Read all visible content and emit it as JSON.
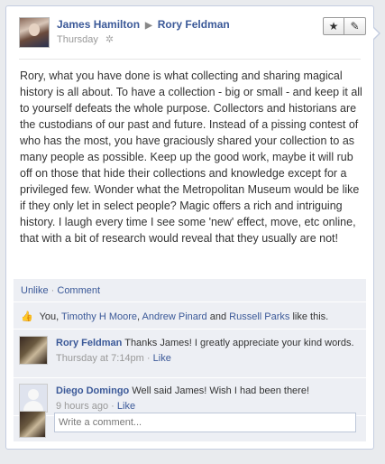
{
  "post": {
    "author": "James Hamilton",
    "recipient": "Rory Feldman",
    "time": "Thursday",
    "body": "Rory, what you have done is what collecting and sharing magical history is all about. To have a collection - big or small - and keep it all to yourself defeats the whole purpose. Collectors and historians are the custodians of our past and future. Instead of a pissing contest of who has the most, you have graciously shared your collection to as many people as possible. Keep up the good work, maybe it will rub off on those that hide their collections and knowledge except for a privileged few. Wonder what the Metropolitan Museum would be like if they only let in select people? Magic offers a rich and intriguing history. I laugh every time I see some 'new' effect, move, etc online, that with a bit of research would reveal that they usually are not!"
  },
  "actions": {
    "unlike": "Unlike",
    "comment": "Comment",
    "separator": "·"
  },
  "likes": {
    "you": "You,",
    "people": [
      "Timothy H Moore",
      "Andrew Pinard",
      "Russell Parks"
    ],
    "comma": ",",
    "and": "and",
    "suffix": "like this."
  },
  "comments": [
    {
      "author": "Rory Feldman",
      "text": "Thanks James! I greatly appreciate your kind words.",
      "time": "Thursday at 7:14pm",
      "like": "Like"
    },
    {
      "author": "Diego Domingo",
      "text": "Well said James! Wish I had been there!",
      "time": "9 hours ago",
      "like": "Like"
    }
  ],
  "composer": {
    "placeholder": "Write a comment..."
  },
  "icons": {
    "arrow": "▶",
    "gear": "✲",
    "star": "★",
    "pencil": "✎",
    "thumb": "👍"
  },
  "colors": {
    "link": "#3b5998",
    "feedback_bg": "#edeff4"
  }
}
